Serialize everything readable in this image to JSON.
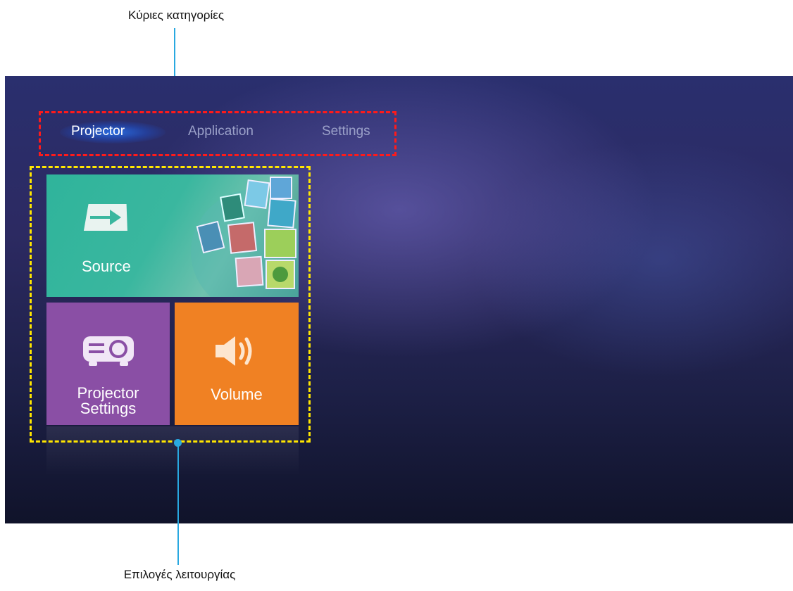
{
  "callouts": {
    "top": "Κύριες κατηγορίες",
    "bottom": "Επιλογές λειτουργίας"
  },
  "tabs": [
    {
      "label": "Projector",
      "active": true
    },
    {
      "label": "Application",
      "active": false
    },
    {
      "label": "Settings",
      "active": false
    }
  ],
  "tiles": {
    "source": {
      "label": "Source",
      "icon": "input-source-icon",
      "color": "#2fb49b"
    },
    "projector_settings": {
      "label_line1": "Projector",
      "label_line2": "Settings",
      "icon": "projector-icon",
      "color": "#8a4fa5"
    },
    "volume": {
      "label": "Volume",
      "icon": "speaker-icon",
      "color": "#f08123"
    }
  },
  "colors": {
    "leader": "#29a8e0",
    "category_box": "#ff1a1a",
    "options_box": "#ffe600"
  }
}
